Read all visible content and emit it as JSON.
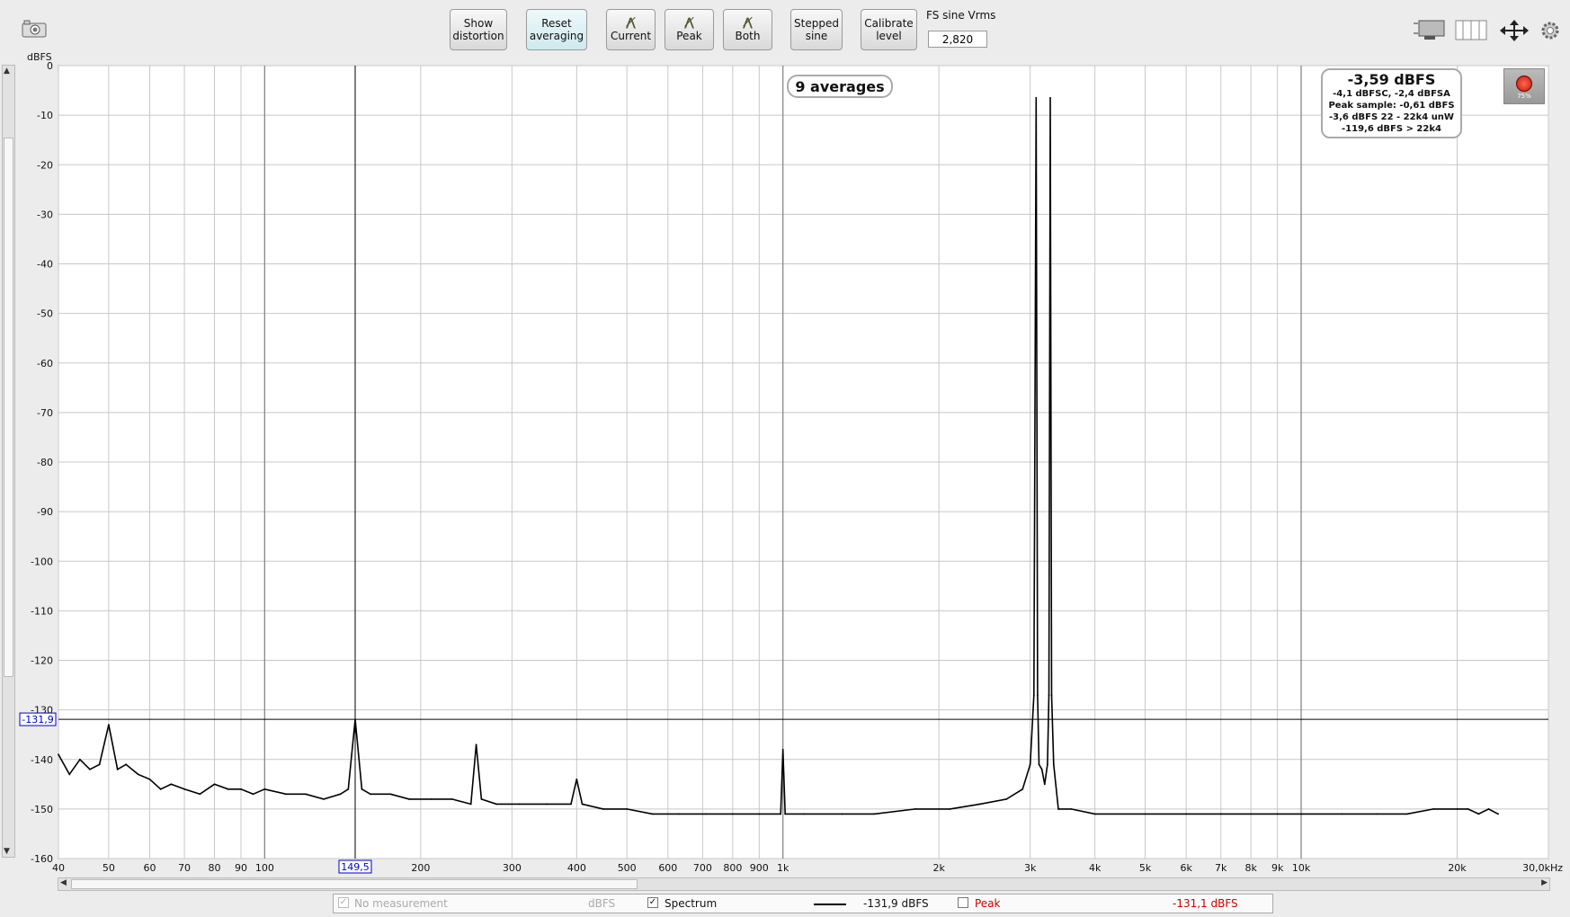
{
  "toolbar": {
    "show_distortion": [
      "Show",
      "distortion"
    ],
    "reset_averaging": [
      "Reset",
      "averaging"
    ],
    "current": "Current",
    "peak": "Peak",
    "both": "Both",
    "stepped_sine": [
      "Stepped",
      "sine"
    ],
    "calibrate_level": [
      "Calibrate",
      "level"
    ],
    "fs_label": "FS sine Vrms",
    "fs_value": "2,820"
  },
  "icons": {
    "camera": "camera-icon",
    "layout": "layout-icon",
    "columns": "columns-icon",
    "move": "move-arrows-icon",
    "settings": "gear-icon",
    "record": "record-level-icon"
  },
  "colors": {
    "trace": "#000000",
    "cursor_label": "#0000cc",
    "peak_text": "#cc0000",
    "record_led": "#e03020"
  },
  "plot": {
    "unit": "dBFS",
    "averages_label": "9 averages",
    "record_level": "75%",
    "info": {
      "main": "-3,59 dBFS",
      "line1": "-4,1 dBFSC, -2,4 dBFSA",
      "line2": "Peak sample: -0,61 dBFS",
      "line3": "-3,6 dBFS 22 - 22k4 unW",
      "line4": "-119,6 dBFS > 22k4"
    },
    "cursor_x_label": "149,5",
    "cursor_y_label": "-131,9"
  },
  "chart_data": {
    "type": "line",
    "xscale": "log",
    "xlim": [
      40,
      30000
    ],
    "ylim": [
      -160,
      0
    ],
    "ylabel": "dBFS",
    "grid": true,
    "y_ticks": [
      0,
      -10,
      -20,
      -30,
      -40,
      -50,
      -60,
      -70,
      -80,
      -90,
      -100,
      -110,
      -120,
      -130,
      -140,
      -150,
      -160
    ],
    "x_ticks": [
      {
        "v": 40,
        "label": "40"
      },
      {
        "v": 50,
        "label": "50"
      },
      {
        "v": 60,
        "label": "60"
      },
      {
        "v": 70,
        "label": "70"
      },
      {
        "v": 80,
        "label": "80"
      },
      {
        "v": 90,
        "label": "90"
      },
      {
        "v": 100,
        "label": "100"
      },
      {
        "v": 200,
        "label": "200"
      },
      {
        "v": 300,
        "label": "300"
      },
      {
        "v": 400,
        "label": "400"
      },
      {
        "v": 500,
        "label": "500"
      },
      {
        "v": 600,
        "label": "600"
      },
      {
        "v": 700,
        "label": "700"
      },
      {
        "v": 800,
        "label": "800"
      },
      {
        "v": 900,
        "label": "900"
      },
      {
        "v": 1000,
        "label": "1k"
      },
      {
        "v": 2000,
        "label": "2k"
      },
      {
        "v": 3000,
        "label": "3k"
      },
      {
        "v": 4000,
        "label": "4k"
      },
      {
        "v": 5000,
        "label": "5k"
      },
      {
        "v": 6000,
        "label": "6k"
      },
      {
        "v": 7000,
        "label": "7k"
      },
      {
        "v": 8000,
        "label": "8k"
      },
      {
        "v": 9000,
        "label": "9k"
      },
      {
        "v": 10000,
        "label": "10k"
      },
      {
        "v": 20000,
        "label": "20k"
      },
      {
        "v": 30000,
        "label": "30,0kHz"
      }
    ],
    "heavy_grid": [
      100,
      1000,
      10000
    ],
    "cursor": {
      "x": 149.5,
      "y": -131.9
    },
    "series": [
      {
        "name": "Spectrum",
        "x": [
          40,
          42,
          44,
          46,
          48,
          50,
          52,
          54,
          57,
          60,
          63,
          66,
          70,
          75,
          80,
          85,
          90,
          95,
          100,
          110,
          120,
          130,
          140,
          145,
          149.5,
          154,
          160,
          175,
          190,
          210,
          230,
          250,
          256,
          262,
          280,
          310,
          350,
          390,
          400,
          410,
          450,
          500,
          560,
          630,
          710,
          800,
          900,
          990,
          1000,
          1010,
          1100,
          1300,
          1500,
          1800,
          2100,
          2400,
          2700,
          2900,
          3000,
          3050,
          3080,
          3100,
          3120,
          3160,
          3200,
          3240,
          3260,
          3280,
          3300,
          3330,
          3400,
          3600,
          4000,
          5000,
          6000,
          7000,
          8000,
          9000,
          10000,
          12000,
          14000,
          16000,
          18000,
          20000,
          21000,
          22000,
          23000,
          24000
        ],
        "y": [
          -139,
          -143,
          -140,
          -142,
          -141,
          -133,
          -142,
          -141,
          -143,
          -144,
          -146,
          -145,
          -146,
          -147,
          -145,
          -146,
          -146,
          -147,
          -146,
          -147,
          -147,
          -148,
          -147,
          -146,
          -131.9,
          -146,
          -147,
          -147,
          -148,
          -148,
          -148,
          -149,
          -137,
          -148,
          -149,
          -149,
          -149,
          -149,
          -144,
          -149,
          -150,
          -150,
          -151,
          -151,
          -151,
          -151,
          -151,
          -151,
          -138,
          -151,
          -151,
          -151,
          -151,
          -150,
          -150,
          -149,
          -148,
          -146,
          -141,
          -127,
          -6.5,
          -127,
          -141,
          -142,
          -145,
          -141,
          -127,
          -6.5,
          -127,
          -141,
          -150,
          -150,
          -151,
          -151,
          -151,
          -151,
          -151,
          -151,
          -151,
          -151,
          -151,
          -151,
          -150,
          -150,
          -150,
          -151,
          -150,
          -151
        ]
      }
    ]
  },
  "legend": {
    "no_measurement": "No measurement",
    "no_measurement_unit": "dBFS",
    "spectrum": "Spectrum",
    "spectrum_value": "-131,9 dBFS",
    "peak": "Peak",
    "peak_value": "-131,1 dBFS"
  }
}
